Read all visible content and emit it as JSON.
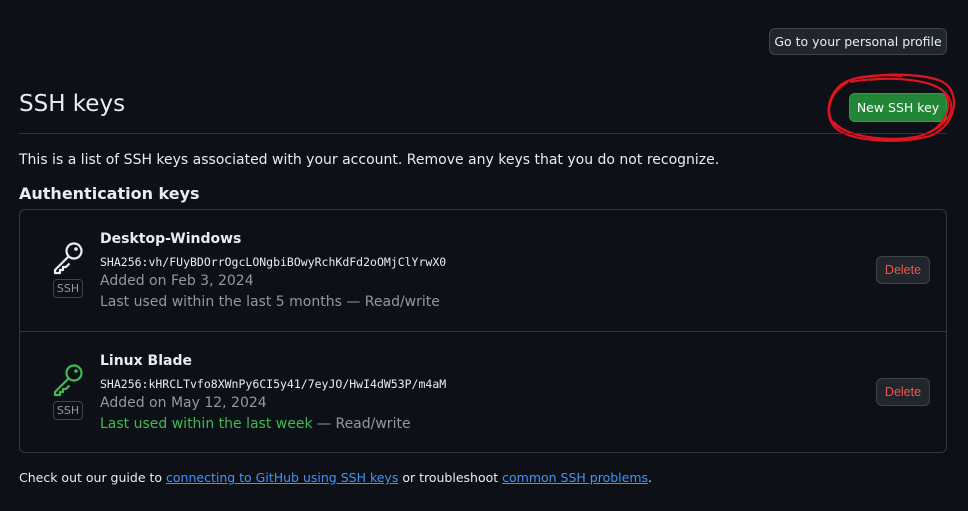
{
  "header": {
    "profile_button_label": "Go to your personal profile",
    "title": "SSH keys",
    "new_key_button_label": "New SSH key"
  },
  "intro_text": "This is a list of SSH keys associated with your account. Remove any keys that you do not recognize.",
  "section_heading": "Authentication keys",
  "keys": [
    {
      "name": "Desktop-Windows",
      "fingerprint": "SHA256:vh/FUyBDOrrOgcLONgbiBOwyRchKdFd2oOMjClYrwX0",
      "added": "Added on Feb 3, 2024",
      "last_used": "Last used within the last 5 months",
      "access": "— Read/write",
      "badge": "SSH",
      "delete_label": "Delete",
      "icon": "key-icon",
      "icon_color": "#e6edf3"
    },
    {
      "name": "Linux Blade",
      "fingerprint": "SHA256:kHRCLTvfo8XWnPy6CI5y41/7eyJO/HwI4dW53P/m4aM",
      "added": "Added on May 12, 2024",
      "last_used": "Last used within the last week",
      "access": "— Read/write",
      "badge": "SSH",
      "delete_label": "Delete",
      "icon": "key-icon",
      "icon_color": "#3fb950"
    }
  ],
  "footer": {
    "prefix": "Check out our guide to ",
    "link1": "connecting to GitHub using SSH keys",
    "middle": " or troubleshoot ",
    "link2": "common SSH problems",
    "suffix": "."
  },
  "colors": {
    "background": "#0d1117",
    "primary_button": "#238636",
    "danger_text": "#f85149",
    "link": "#4493f8",
    "annotation": "#e0141e"
  }
}
